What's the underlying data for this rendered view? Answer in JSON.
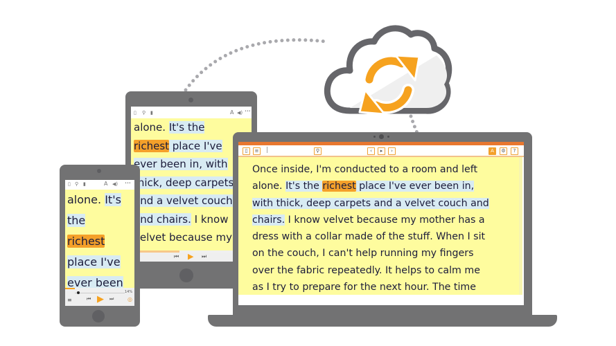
{
  "colors": {
    "device": "#727273",
    "page_bg": "#fefc9e",
    "sentence_highlight": "#d8ebf3",
    "word_highlight": "#f4a02a",
    "accent": "#e8772f",
    "text": "#1c1c3a",
    "dots": "#a9a9ad"
  },
  "cloud": {
    "icon": "cloud-sync-icon"
  },
  "laptop": {
    "toolbar": {
      "left": [
        "book-icon",
        "notes-icon",
        "text-cursor"
      ],
      "center": [
        "search-icon",
        "prev-icon",
        "play-icon",
        "next-icon"
      ],
      "right": [
        "text-style-icon",
        "settings-icon",
        "help-icon"
      ],
      "help_label": "?"
    },
    "lines": [
      {
        "pre": "Once inside, I'm conducted to a room and left",
        "hl": "",
        "word": "",
        "post_hl": "",
        "post": ""
      },
      {
        "pre": "alone. ",
        "hl": "It's the ",
        "word": "richest",
        "post_hl": " place I've ever been in,",
        "post": ""
      },
      {
        "pre": "",
        "hl": "with thick, deep carpets and a velvet couch and",
        "word": "",
        "post_hl": "",
        "post": ""
      },
      {
        "pre": "",
        "hl": "chairs.",
        "word": "",
        "post_hl": "",
        "post": " I know velvet because my mother has a"
      },
      {
        "pre": "dress with a collar made of the stuff. When I sit",
        "hl": "",
        "word": "",
        "post_hl": "",
        "post": ""
      },
      {
        "pre": "on the couch, I can't help running my fingers",
        "hl": "",
        "word": "",
        "post_hl": "",
        "post": ""
      },
      {
        "pre": "over the fabric repeatedly. It helps to calm me",
        "hl": "",
        "word": "",
        "post_hl": "",
        "post": ""
      },
      {
        "pre": "as I try to prepare for the next hour. The time",
        "hl": "",
        "word": "",
        "post_hl": "",
        "post": ""
      }
    ]
  },
  "tablet": {
    "toolbar": {
      "left": [
        "book-icon",
        "search-icon",
        "bookmark-icon"
      ],
      "right": [
        "font-icon",
        "audio-icon",
        "more-icon"
      ],
      "font_label": "A",
      "more_label": "•••"
    },
    "lines": [
      {
        "pre": "alone. ",
        "hl": "It's the",
        "word": "",
        "post": ""
      },
      {
        "pre": "",
        "hl": "",
        "word": "richest",
        "post": " place I've"
      },
      {
        "pre": "",
        "hl": "ever been in, with",
        "word": "",
        "post": ""
      },
      {
        "pre": "",
        "hl": "thick, deep carpets",
        "word": "",
        "post": ""
      },
      {
        "pre": "",
        "hl": "and a velvet couch",
        "word": "",
        "post": ""
      },
      {
        "pre": "",
        "hl": "and chairs.",
        "word": "",
        "post": " I know"
      },
      {
        "pre": "velvet because my",
        "hl": "",
        "word": "",
        "post": ""
      }
    ],
    "progress": 0.4
  },
  "phone": {
    "toolbar": {
      "left": [
        "book-icon",
        "search-icon",
        "bookmark-icon"
      ],
      "right": [
        "font-icon",
        "audio-icon",
        "more-icon"
      ],
      "font_label": "A",
      "more_label": "•••"
    },
    "lines": [
      {
        "pre": "alone. ",
        "hl": "It's",
        "word": ""
      },
      {
        "pre": "",
        "hl": "the",
        "word": ""
      },
      {
        "pre": "",
        "hl": "",
        "word": "richest"
      },
      {
        "pre": "",
        "hl": "place I've",
        "word": ""
      },
      {
        "pre": "",
        "hl": "ever been",
        "word": ""
      }
    ],
    "percent_label": "14%",
    "progress": 0.14
  }
}
